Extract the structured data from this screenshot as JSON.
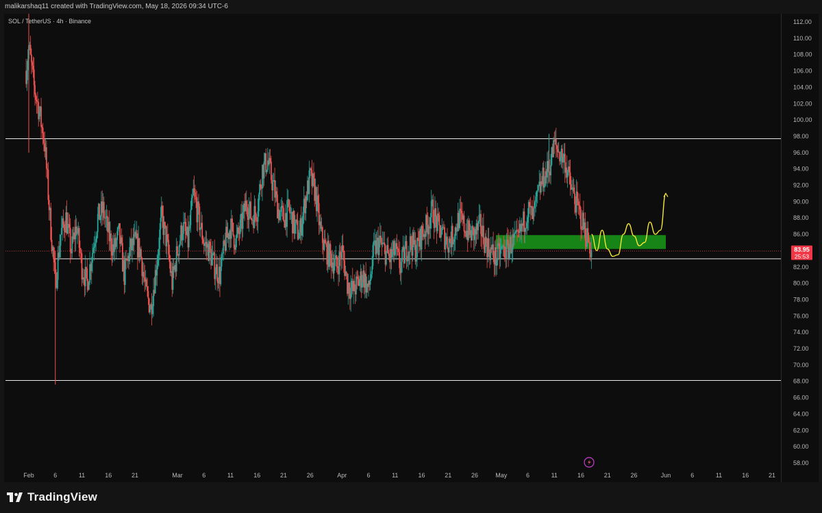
{
  "header": {
    "credit": "malikarshaq11 created with TradingView.com, May 18, 2026 09:34 UTC-6"
  },
  "symbol_info": "SOL / TetherUS · 4h · Binance",
  "branding": {
    "logo_text": "TradingView"
  },
  "colors": {
    "up": "#26a69a",
    "down": "#ef5350",
    "zone": "#1a9a1a",
    "projection": "#f5e635",
    "level_line": "#e8e8e8",
    "price_label_bg": "#f23645"
  },
  "last_price": {
    "value": "83.95",
    "countdown": "25:53"
  },
  "chart_data": {
    "type": "candlestick",
    "symbol": "SOL / TetherUS",
    "timeframe": "4h",
    "exchange": "Binance",
    "ylim": [
      57,
      113
    ],
    "y_ticks": [
      "58.00",
      "60.00",
      "62.00",
      "64.00",
      "66.00",
      "68.00",
      "70.00",
      "72.00",
      "74.00",
      "76.00",
      "78.00",
      "80.00",
      "82.00",
      "84.00",
      "86.00",
      "88.00",
      "90.00",
      "92.00",
      "94.00",
      "96.00",
      "98.00",
      "100.00",
      "102.00",
      "104.00",
      "106.00",
      "108.00",
      "110.00",
      "112.00"
    ],
    "x_axis": {
      "start": "2026-02-01",
      "end": "2026-06-26",
      "ticks": [
        {
          "date": "2026-02-01",
          "label": "Feb"
        },
        {
          "date": "2026-02-06",
          "label": "6"
        },
        {
          "date": "2026-02-11",
          "label": "11"
        },
        {
          "date": "2026-02-16",
          "label": "16"
        },
        {
          "date": "2026-02-21",
          "label": "21"
        },
        {
          "date": "2026-03-01",
          "label": "Mar"
        },
        {
          "date": "2026-03-06",
          "label": "6"
        },
        {
          "date": "2026-03-11",
          "label": "11"
        },
        {
          "date": "2026-03-16",
          "label": "16"
        },
        {
          "date": "2026-03-21",
          "label": "21"
        },
        {
          "date": "2026-03-26",
          "label": "26"
        },
        {
          "date": "2026-04-01",
          "label": "Apr"
        },
        {
          "date": "2026-04-06",
          "label": "6"
        },
        {
          "date": "2026-04-11",
          "label": "11"
        },
        {
          "date": "2026-04-16",
          "label": "16"
        },
        {
          "date": "2026-04-21",
          "label": "21"
        },
        {
          "date": "2026-04-26",
          "label": "26"
        },
        {
          "date": "2026-05-01",
          "label": "May"
        },
        {
          "date": "2026-05-06",
          "label": "6"
        },
        {
          "date": "2026-05-11",
          "label": "11"
        },
        {
          "date": "2026-05-16",
          "label": "16"
        },
        {
          "date": "2026-05-21",
          "label": "21"
        },
        {
          "date": "2026-05-26",
          "label": "26"
        },
        {
          "date": "2026-06-01",
          "label": "Jun"
        },
        {
          "date": "2026-06-06",
          "label": "6"
        },
        {
          "date": "2026-06-11",
          "label": "11"
        },
        {
          "date": "2026-06-16",
          "label": "16"
        },
        {
          "date": "2026-06-21",
          "label": "21"
        }
      ]
    },
    "price_path": [
      {
        "date": "2026-01-31",
        "price": 103
      },
      {
        "date": "2026-02-01",
        "price": 109
      },
      {
        "date": "2026-02-02",
        "price": 104
      },
      {
        "date": "2026-02-03",
        "price": 101
      },
      {
        "date": "2026-02-04",
        "price": 97
      },
      {
        "date": "2026-02-05",
        "price": 88
      },
      {
        "date": "2026-02-06",
        "price": 80
      },
      {
        "date": "2026-02-07",
        "price": 86
      },
      {
        "date": "2026-02-08",
        "price": 88
      },
      {
        "date": "2026-02-09",
        "price": 84
      },
      {
        "date": "2026-02-10",
        "price": 87
      },
      {
        "date": "2026-02-11",
        "price": 82
      },
      {
        "date": "2026-02-12",
        "price": 80
      },
      {
        "date": "2026-02-13",
        "price": 84
      },
      {
        "date": "2026-02-14",
        "price": 88
      },
      {
        "date": "2026-02-15",
        "price": 89
      },
      {
        "date": "2026-02-16",
        "price": 86
      },
      {
        "date": "2026-02-17",
        "price": 84
      },
      {
        "date": "2026-02-18",
        "price": 86
      },
      {
        "date": "2026-02-19",
        "price": 81
      },
      {
        "date": "2026-02-20",
        "price": 84
      },
      {
        "date": "2026-02-21",
        "price": 85
      },
      {
        "date": "2026-02-22",
        "price": 84
      },
      {
        "date": "2026-02-23",
        "price": 79
      },
      {
        "date": "2026-02-24",
        "price": 77
      },
      {
        "date": "2026-02-25",
        "price": 82
      },
      {
        "date": "2026-02-26",
        "price": 88
      },
      {
        "date": "2026-02-27",
        "price": 85
      },
      {
        "date": "2026-02-28",
        "price": 80
      },
      {
        "date": "2026-03-01",
        "price": 84
      },
      {
        "date": "2026-03-02",
        "price": 87
      },
      {
        "date": "2026-03-03",
        "price": 85
      },
      {
        "date": "2026-03-04",
        "price": 91
      },
      {
        "date": "2026-03-05",
        "price": 88
      },
      {
        "date": "2026-03-06",
        "price": 85
      },
      {
        "date": "2026-03-07",
        "price": 84
      },
      {
        "date": "2026-03-08",
        "price": 82
      },
      {
        "date": "2026-03-09",
        "price": 81
      },
      {
        "date": "2026-03-10",
        "price": 85
      },
      {
        "date": "2026-03-11",
        "price": 87
      },
      {
        "date": "2026-03-12",
        "price": 85
      },
      {
        "date": "2026-03-13",
        "price": 87
      },
      {
        "date": "2026-03-14",
        "price": 90
      },
      {
        "date": "2026-03-15",
        "price": 88
      },
      {
        "date": "2026-03-16",
        "price": 89
      },
      {
        "date": "2026-03-17",
        "price": 94
      },
      {
        "date": "2026-03-18",
        "price": 95
      },
      {
        "date": "2026-03-19",
        "price": 92
      },
      {
        "date": "2026-03-20",
        "price": 89
      },
      {
        "date": "2026-03-21",
        "price": 88
      },
      {
        "date": "2026-03-22",
        "price": 89
      },
      {
        "date": "2026-03-23",
        "price": 87
      },
      {
        "date": "2026-03-24",
        "price": 86
      },
      {
        "date": "2026-03-25",
        "price": 90
      },
      {
        "date": "2026-03-26",
        "price": 93
      },
      {
        "date": "2026-03-27",
        "price": 91
      },
      {
        "date": "2026-03-28",
        "price": 86
      },
      {
        "date": "2026-03-29",
        "price": 84
      },
      {
        "date": "2026-03-30",
        "price": 83
      },
      {
        "date": "2026-03-31",
        "price": 82
      },
      {
        "date": "2026-04-01",
        "price": 84
      },
      {
        "date": "2026-04-02",
        "price": 80
      },
      {
        "date": "2026-04-03",
        "price": 79
      },
      {
        "date": "2026-04-04",
        "price": 80
      },
      {
        "date": "2026-04-05",
        "price": 81
      },
      {
        "date": "2026-04-06",
        "price": 79
      },
      {
        "date": "2026-04-07",
        "price": 84
      },
      {
        "date": "2026-04-08",
        "price": 85
      },
      {
        "date": "2026-04-09",
        "price": 84
      },
      {
        "date": "2026-04-10",
        "price": 83
      },
      {
        "date": "2026-04-11",
        "price": 84
      },
      {
        "date": "2026-04-12",
        "price": 82
      },
      {
        "date": "2026-04-13",
        "price": 84
      },
      {
        "date": "2026-04-14",
        "price": 85
      },
      {
        "date": "2026-04-15",
        "price": 84
      },
      {
        "date": "2026-04-16",
        "price": 86
      },
      {
        "date": "2026-04-17",
        "price": 87
      },
      {
        "date": "2026-04-18",
        "price": 89
      },
      {
        "date": "2026-04-19",
        "price": 87
      },
      {
        "date": "2026-04-20",
        "price": 86
      },
      {
        "date": "2026-04-21",
        "price": 85
      },
      {
        "date": "2026-04-22",
        "price": 86
      },
      {
        "date": "2026-04-23",
        "price": 88
      },
      {
        "date": "2026-04-24",
        "price": 87
      },
      {
        "date": "2026-04-25",
        "price": 86
      },
      {
        "date": "2026-04-26",
        "price": 86
      },
      {
        "date": "2026-04-27",
        "price": 87
      },
      {
        "date": "2026-04-28",
        "price": 85
      },
      {
        "date": "2026-04-29",
        "price": 84
      },
      {
        "date": "2026-04-30",
        "price": 83
      },
      {
        "date": "2026-05-01",
        "price": 84
      },
      {
        "date": "2026-05-02",
        "price": 84
      },
      {
        "date": "2026-05-03",
        "price": 85
      },
      {
        "date": "2026-05-04",
        "price": 85
      },
      {
        "date": "2026-05-05",
        "price": 87
      },
      {
        "date": "2026-05-06",
        "price": 89
      },
      {
        "date": "2026-05-07",
        "price": 88
      },
      {
        "date": "2026-05-08",
        "price": 91
      },
      {
        "date": "2026-05-09",
        "price": 93
      },
      {
        "date": "2026-05-10",
        "price": 94
      },
      {
        "date": "2026-05-11",
        "price": 97
      },
      {
        "date": "2026-05-12",
        "price": 96
      },
      {
        "date": "2026-05-13",
        "price": 95
      },
      {
        "date": "2026-05-14",
        "price": 92
      },
      {
        "date": "2026-05-15",
        "price": 90
      },
      {
        "date": "2026-05-16",
        "price": 88
      },
      {
        "date": "2026-05-17",
        "price": 86
      },
      {
        "date": "2026-05-18",
        "price": 84
      }
    ],
    "candle_spread": 2,
    "levels": [
      {
        "price": 97.7
      },
      {
        "price": 83.0
      },
      {
        "price": 68.1
      }
    ],
    "zone": {
      "from": "2026-04-30",
      "to": "2026-06-01",
      "low": 84.2,
      "high": 85.9
    },
    "projection_path": [
      {
        "date": "2026-05-18",
        "price": 86
      },
      {
        "date": "2026-05-19",
        "price": 84
      },
      {
        "date": "2026-05-20",
        "price": 86.5
      },
      {
        "date": "2026-05-21",
        "price": 84.2
      },
      {
        "date": "2026-05-22",
        "price": 83.3
      },
      {
        "date": "2026-05-23",
        "price": 83.5
      },
      {
        "date": "2026-05-24",
        "price": 86
      },
      {
        "date": "2026-05-25",
        "price": 87.3
      },
      {
        "date": "2026-05-26",
        "price": 85.8
      },
      {
        "date": "2026-05-27",
        "price": 84.6
      },
      {
        "date": "2026-05-28",
        "price": 85
      },
      {
        "date": "2026-05-29",
        "price": 87.5
      },
      {
        "date": "2026-05-30",
        "price": 86
      },
      {
        "date": "2026-05-31",
        "price": 86.5
      },
      {
        "date": "2026-06-01",
        "price": 91
      }
    ]
  }
}
